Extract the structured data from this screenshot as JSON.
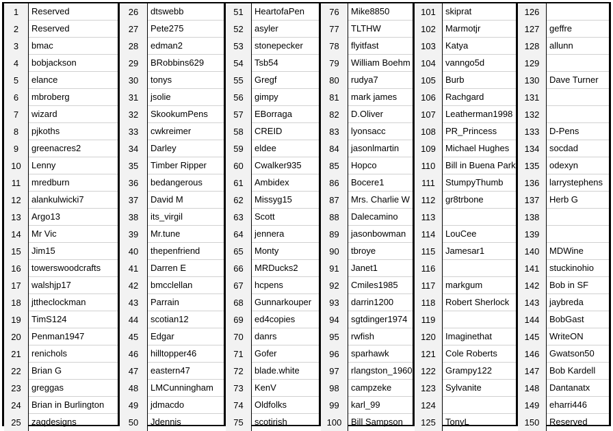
{
  "sheet": {
    "blocks": [
      {
        "rows": [
          {
            "num": "1",
            "name": "Reserved"
          },
          {
            "num": "2",
            "name": "Reserved"
          },
          {
            "num": "3",
            "name": "bmac"
          },
          {
            "num": "4",
            "name": "bobjackson"
          },
          {
            "num": "5",
            "name": "elance"
          },
          {
            "num": "6",
            "name": "mbroberg"
          },
          {
            "num": "7",
            "name": "wizard"
          },
          {
            "num": "8",
            "name": "pjkoths"
          },
          {
            "num": "9",
            "name": "greenacres2"
          },
          {
            "num": "10",
            "name": "Lenny"
          },
          {
            "num": "11",
            "name": "mredburn"
          },
          {
            "num": "12",
            "name": "alankulwicki7"
          },
          {
            "num": "13",
            "name": "Argo13"
          },
          {
            "num": "14",
            "name": "Mr Vic"
          },
          {
            "num": "15",
            "name": "Jim15"
          },
          {
            "num": "16",
            "name": "towerswoodcrafts"
          },
          {
            "num": "17",
            "name": "walshjp17"
          },
          {
            "num": "18",
            "name": "jttheclockman"
          },
          {
            "num": "19",
            "name": "TimS124"
          },
          {
            "num": "20",
            "name": "Penman1947"
          },
          {
            "num": "21",
            "name": "renichols"
          },
          {
            "num": "22",
            "name": "Brian G"
          },
          {
            "num": "23",
            "name": "greggas"
          },
          {
            "num": "24",
            "name": "Brian in Burlington"
          },
          {
            "num": "25",
            "name": "zaqdesigns"
          }
        ]
      },
      {
        "rows": [
          {
            "num": "26",
            "name": "dtswebb"
          },
          {
            "num": "27",
            "name": "Pete275"
          },
          {
            "num": "28",
            "name": "edman2"
          },
          {
            "num": "29",
            "name": "BRobbins629"
          },
          {
            "num": "30",
            "name": "tonys"
          },
          {
            "num": "31",
            "name": "jsolie"
          },
          {
            "num": "32",
            "name": "SkookumPens"
          },
          {
            "num": "33",
            "name": "cwkreimer"
          },
          {
            "num": "34",
            "name": "Darley"
          },
          {
            "num": "35",
            "name": "Timber Ripper"
          },
          {
            "num": "36",
            "name": "bedangerous"
          },
          {
            "num": "37",
            "name": "David M"
          },
          {
            "num": "38",
            "name": "its_virgil"
          },
          {
            "num": "39",
            "name": "Mr.tune"
          },
          {
            "num": "40",
            "name": "thepenfriend"
          },
          {
            "num": "41",
            "name": "Darren E"
          },
          {
            "num": "42",
            "name": "bmcclellan"
          },
          {
            "num": "43",
            "name": "Parrain"
          },
          {
            "num": "44",
            "name": "scotian12"
          },
          {
            "num": "45",
            "name": "Edgar"
          },
          {
            "num": "46",
            "name": "hilltopper46"
          },
          {
            "num": "47",
            "name": "eastern47"
          },
          {
            "num": "48",
            "name": "LMCunningham"
          },
          {
            "num": "49",
            "name": "jdmacdo"
          },
          {
            "num": "50",
            "name": "Jdennis"
          }
        ]
      },
      {
        "rows": [
          {
            "num": "51",
            "name": "HeartofaPen"
          },
          {
            "num": "52",
            "name": "asyler"
          },
          {
            "num": "53",
            "name": "stonepecker"
          },
          {
            "num": "54",
            "name": "Tsb54"
          },
          {
            "num": "55",
            "name": "Gregf"
          },
          {
            "num": "56",
            "name": "gimpy"
          },
          {
            "num": "57",
            "name": "EBorraga"
          },
          {
            "num": "58",
            "name": "CREID"
          },
          {
            "num": "59",
            "name": "eldee"
          },
          {
            "num": "60",
            "name": "Cwalker935"
          },
          {
            "num": "61",
            "name": "Ambidex"
          },
          {
            "num": "62",
            "name": "Missyg15"
          },
          {
            "num": "63",
            "name": "Scott"
          },
          {
            "num": "64",
            "name": "jennera"
          },
          {
            "num": "65",
            "name": "Monty"
          },
          {
            "num": "66",
            "name": "MRDucks2"
          },
          {
            "num": "67",
            "name": "hcpens"
          },
          {
            "num": "68",
            "name": "Gunnarkouper"
          },
          {
            "num": "69",
            "name": "ed4copies"
          },
          {
            "num": "70",
            "name": "danrs"
          },
          {
            "num": "71",
            "name": "Gofer"
          },
          {
            "num": "72",
            "name": "blade.white"
          },
          {
            "num": "73",
            "name": "KenV"
          },
          {
            "num": "74",
            "name": "Oldfolks"
          },
          {
            "num": "75",
            "name": "scotirish"
          }
        ]
      },
      {
        "rows": [
          {
            "num": "76",
            "name": "Mike8850"
          },
          {
            "num": "77",
            "name": "TLTHW"
          },
          {
            "num": "78",
            "name": "flyitfast"
          },
          {
            "num": "79",
            "name": "William Boehm"
          },
          {
            "num": "80",
            "name": "rudya7"
          },
          {
            "num": "81",
            "name": "mark james"
          },
          {
            "num": "82",
            "name": "D.Oliver"
          },
          {
            "num": "83",
            "name": "lyonsacc"
          },
          {
            "num": "84",
            "name": "jasonlmartin"
          },
          {
            "num": "85",
            "name": "Hopco"
          },
          {
            "num": "86",
            "name": "Bocere1"
          },
          {
            "num": "87",
            "name": "Mrs. Charlie W"
          },
          {
            "num": "88",
            "name": "Dalecamino"
          },
          {
            "num": "89",
            "name": "jasonbowman"
          },
          {
            "num": "90",
            "name": "tbroye"
          },
          {
            "num": "91",
            "name": "Janet1"
          },
          {
            "num": "92",
            "name": "Cmiles1985"
          },
          {
            "num": "93",
            "name": "darrin1200"
          },
          {
            "num": "94",
            "name": "sgtdinger1974"
          },
          {
            "num": "95",
            "name": "rwfish"
          },
          {
            "num": "96",
            "name": "sparhawk"
          },
          {
            "num": "97",
            "name": "rlangston_1960"
          },
          {
            "num": "98",
            "name": "campzeke"
          },
          {
            "num": "99",
            "name": "karl_99"
          },
          {
            "num": "100",
            "name": "Bill Sampson"
          }
        ]
      },
      {
        "rows": [
          {
            "num": "101",
            "name": "skiprat"
          },
          {
            "num": "102",
            "name": "Marmotjr"
          },
          {
            "num": "103",
            "name": "Katya"
          },
          {
            "num": "104",
            "name": "vanngo5d"
          },
          {
            "num": "105",
            "name": "Burb"
          },
          {
            "num": "106",
            "name": "Rachgard"
          },
          {
            "num": "107",
            "name": "Leatherman1998"
          },
          {
            "num": "108",
            "name": "PR_Princess"
          },
          {
            "num": "109",
            "name": "Michael Hughes"
          },
          {
            "num": "110",
            "name": "Bill in Buena Park"
          },
          {
            "num": "111",
            "name": "StumpyThumb"
          },
          {
            "num": "112",
            "name": "gr8trbone"
          },
          {
            "num": "113",
            "name": ""
          },
          {
            "num": "114",
            "name": "LouCee"
          },
          {
            "num": "115",
            "name": "Jamesar1"
          },
          {
            "num": "116",
            "name": ""
          },
          {
            "num": "117",
            "name": "markgum"
          },
          {
            "num": "118",
            "name": "Robert Sherlock"
          },
          {
            "num": "119",
            "name": ""
          },
          {
            "num": "120",
            "name": "Imaginethat"
          },
          {
            "num": "121",
            "name": "Cole Roberts"
          },
          {
            "num": "122",
            "name": "Grampy122"
          },
          {
            "num": "123",
            "name": "Sylvanite"
          },
          {
            "num": "124",
            "name": ""
          },
          {
            "num": "125",
            "name": "TonyL"
          }
        ]
      },
      {
        "rows": [
          {
            "num": "126",
            "name": ""
          },
          {
            "num": "127",
            "name": "geffre"
          },
          {
            "num": "128",
            "name": "allunn"
          },
          {
            "num": "129",
            "name": ""
          },
          {
            "num": "130",
            "name": "Dave Turner"
          },
          {
            "num": "131",
            "name": ""
          },
          {
            "num": "132",
            "name": ""
          },
          {
            "num": "133",
            "name": "D-Pens"
          },
          {
            "num": "134",
            "name": "socdad"
          },
          {
            "num": "135",
            "name": "odexyn"
          },
          {
            "num": "136",
            "name": "larrystephens"
          },
          {
            "num": "137",
            "name": "Herb G"
          },
          {
            "num": "138",
            "name": ""
          },
          {
            "num": "139",
            "name": ""
          },
          {
            "num": "140",
            "name": "MDWine"
          },
          {
            "num": "141",
            "name": "stuckinohio"
          },
          {
            "num": "142",
            "name": "Bob in SF"
          },
          {
            "num": "143",
            "name": "jaybreda"
          },
          {
            "num": "144",
            "name": "BobGast"
          },
          {
            "num": "145",
            "name": "WriteON"
          },
          {
            "num": "146",
            "name": "Gwatson50"
          },
          {
            "num": "147",
            "name": "Bob Kardell"
          },
          {
            "num": "148",
            "name": "Dantanatx"
          },
          {
            "num": "149",
            "name": "eharri446"
          },
          {
            "num": "150",
            "name": "Reserved"
          }
        ]
      }
    ]
  }
}
